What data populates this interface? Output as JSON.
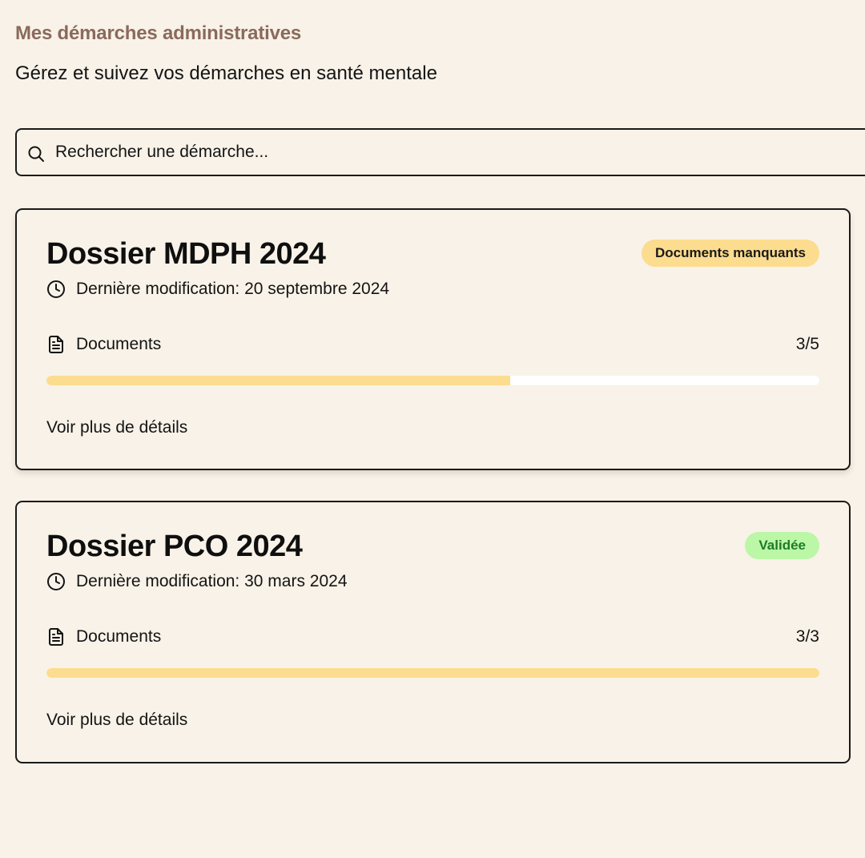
{
  "header": {
    "title": "Mes démarches administratives",
    "subtitle": "Gérez et suivez vos démarches en santé mentale"
  },
  "search": {
    "placeholder": "Rechercher une démarche...",
    "icon": "search-icon"
  },
  "colors": {
    "background": "#f8f2e8",
    "title_brown": "#8a6a5c",
    "badge_warning": "#fcdc8e",
    "badge_success": "#bbf7a6",
    "badge_success_text": "#1f7a2a",
    "progress_fill": "#fcdc8e",
    "progress_track": "#ffffff"
  },
  "dossiers": [
    {
      "title": "Dossier MDPH 2024",
      "status": "Documents manquants",
      "status_type": "warning",
      "modified": "Dernière modification: 20 septembre 2024",
      "documents_label": "Documents",
      "documents_count": "3/5",
      "progress_fraction": 0.6,
      "details_label": "Voir plus de détails",
      "icons": [
        "clock-icon",
        "document-icon"
      ]
    },
    {
      "title": "Dossier PCO 2024",
      "status": "Validée",
      "status_type": "success",
      "modified": "Dernière modification: 30 mars 2024",
      "documents_label": "Documents",
      "documents_count": "3/3",
      "progress_fraction": 1.0,
      "details_label": "Voir plus de détails",
      "icons": [
        "clock-icon",
        "document-icon"
      ]
    }
  ]
}
